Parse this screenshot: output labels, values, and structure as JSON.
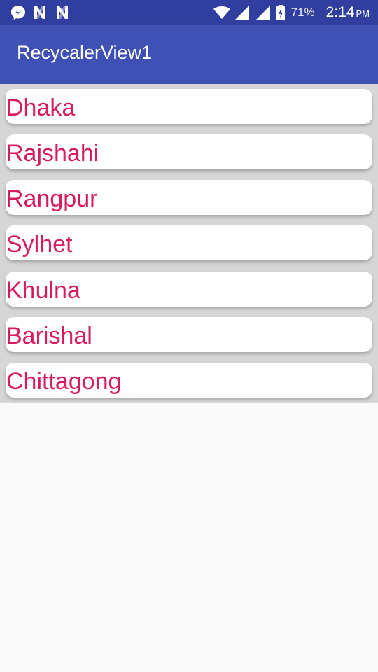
{
  "status_bar": {
    "left_icons": [
      "messenger-icon",
      "n-notification-icon",
      "n-notification-icon"
    ],
    "right_icons": [
      "wifi-icon",
      "signal-icon",
      "signal-icon",
      "battery-charging-icon"
    ],
    "battery": "71%",
    "time": "2:14",
    "ampm": "PM"
  },
  "app_bar": {
    "title": "RecycalerView1"
  },
  "list": {
    "items": [
      {
        "label": "Dhaka"
      },
      {
        "label": "Rajshahi"
      },
      {
        "label": "Rangpur"
      },
      {
        "label": "Sylhet"
      },
      {
        "label": "Khulna"
      },
      {
        "label": "Barishal"
      },
      {
        "label": "Chittagong"
      }
    ]
  },
  "colors": {
    "status_bar": "#303f9f",
    "app_bar": "#3f51b5",
    "item_text": "#d81b60",
    "list_background": "#d6d6d6",
    "page_background": "#fafafa"
  }
}
